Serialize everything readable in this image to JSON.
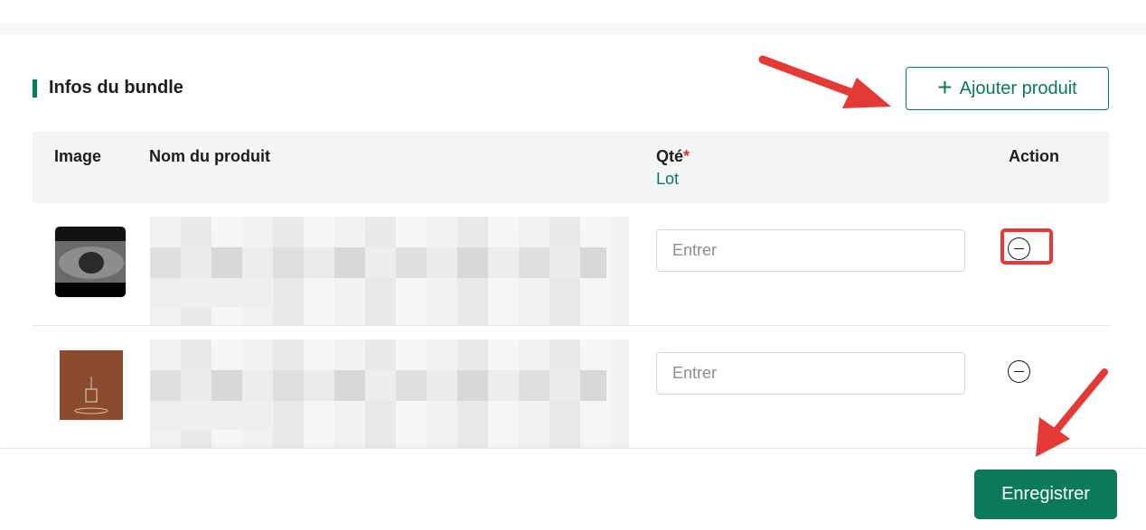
{
  "section": {
    "title": "Infos du bundle",
    "add_label": "Ajouter produit"
  },
  "table": {
    "headers": {
      "image": "Image",
      "name": "Nom du produit",
      "qty": "Qté",
      "qty_required": "*",
      "qty_sub": "Lot",
      "action": "Action"
    },
    "rows": [
      {
        "qty_placeholder": "Entrer",
        "image_desc": "dark-product-photo"
      },
      {
        "qty_placeholder": "Entrer",
        "image_desc": "brown-product-card"
      }
    ]
  },
  "footer": {
    "save_label": "Enregistrer"
  },
  "colors": {
    "accent": "#0b7a5a",
    "annotation": "#e53935",
    "header_bg": "#f4f5f6"
  },
  "icons": {
    "add": "plus-icon",
    "remove": "minus-circle-icon"
  }
}
